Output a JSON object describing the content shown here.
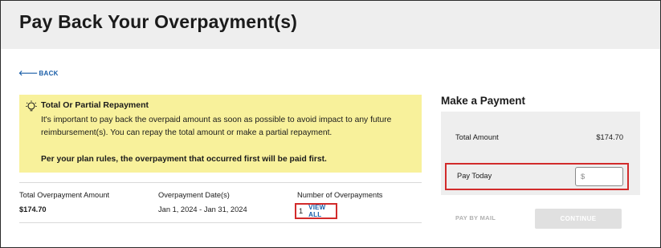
{
  "header": {
    "title": "Pay Back Your Overpayment(s)"
  },
  "nav": {
    "back_label": "BACK"
  },
  "alert": {
    "icon": "lightbulb-icon",
    "title": "Total Or Partial Repayment",
    "body": "It's important to pay back the overpaid amount as soon as possible to avoid impact to any future reimbursement(s). You can repay the total amount or make a partial repayment.",
    "note": "Per your plan rules, the overpayment that occurred first will be paid first.",
    "background_color": "#f8f19b"
  },
  "summary": {
    "total_label": "Total Overpayment Amount",
    "total_value": "$174.70",
    "dates_label": "Overpayment Date(s)",
    "dates_value": "Jan 1, 2024 - Jan 31, 2024",
    "count_label": "Number of Overpayments",
    "count_value": "1",
    "view_all_label": "VIEW ALL"
  },
  "payment": {
    "title": "Make a Payment",
    "total_label": "Total Amount",
    "total_value": "$174.70",
    "pay_today_label": "Pay Today",
    "pay_today_placeholder": "$",
    "pay_today_value": "",
    "pay_by_mail_label": "PAY BY MAIL",
    "continue_label": "CONTINUE"
  },
  "colors": {
    "link": "#1a5ea8",
    "highlight_border": "#d22b2b",
    "panel_bg": "#eeeeee",
    "disabled_button": "#e0e0e0"
  }
}
